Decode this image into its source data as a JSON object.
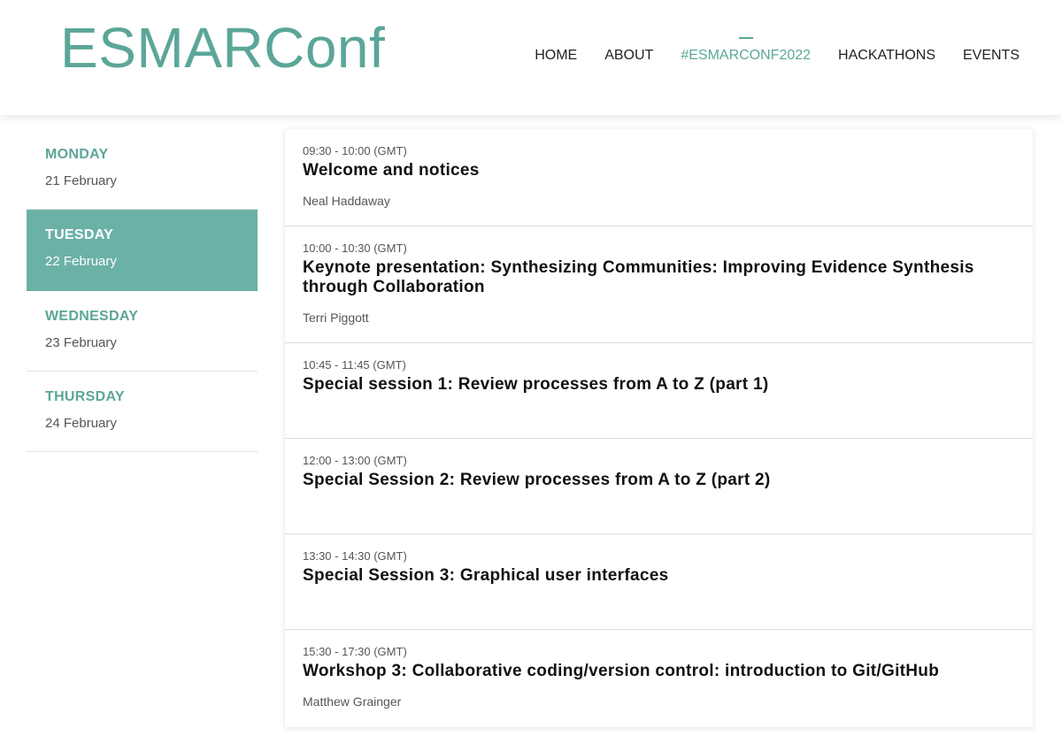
{
  "site": {
    "logo": "ESMARConf"
  },
  "nav": {
    "items": [
      {
        "label": "HOME"
      },
      {
        "label": "ABOUT"
      },
      {
        "label": "#ESMARCONF2022"
      },
      {
        "label": "HACKATHONS"
      },
      {
        "label": "EVENTS"
      }
    ],
    "active": "#ESMARCONF2022"
  },
  "days": [
    {
      "name": "MONDAY",
      "date": "21 February"
    },
    {
      "name": "TUESDAY",
      "date": "22 February"
    },
    {
      "name": "WEDNESDAY",
      "date": "23 February"
    },
    {
      "name": "THURSDAY",
      "date": "24 February"
    }
  ],
  "active_day": "TUESDAY",
  "sessions": [
    {
      "time": "09:30 - 10:00 (GMT)",
      "title": "Welcome and notices",
      "speaker": "Neal Haddaway"
    },
    {
      "time": "10:00 - 10:30 (GMT)",
      "title": "Keynote presentation: Synthesizing Communities: Improving Evidence Synthesis through Collaboration",
      "speaker": "Terri Piggott"
    },
    {
      "time": "10:45 - 11:45 (GMT)",
      "title": "Special session 1: Review processes from A to Z (part 1)",
      "speaker": ""
    },
    {
      "time": "12:00 - 13:00 (GMT)",
      "title": "Special Session 2: Review processes from A to Z (part 2)",
      "speaker": ""
    },
    {
      "time": "13:30 - 14:30 (GMT)",
      "title": "Special Session 3: Graphical user interfaces",
      "speaker": ""
    },
    {
      "time": "15:30 - 17:30 (GMT)",
      "title": "Workshop 3: Collaborative coding/version control: introduction to Git/GitHub",
      "speaker": "Matthew Grainger"
    }
  ],
  "colors": {
    "accent": "#5ba698",
    "active_day_bg": "#6bb1a6"
  }
}
